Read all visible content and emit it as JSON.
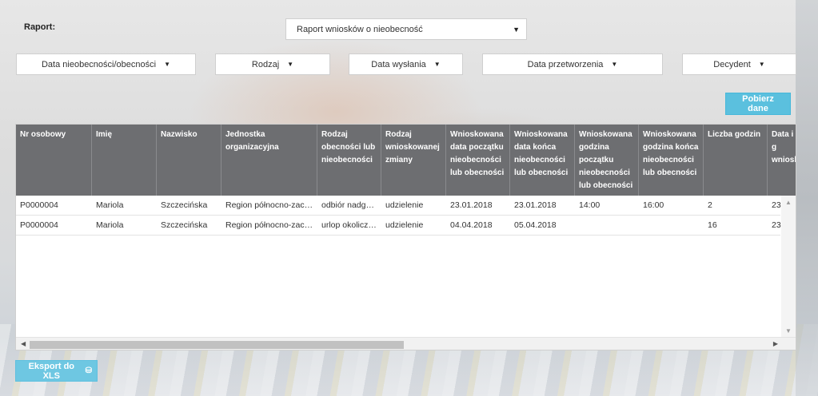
{
  "report": {
    "label": "Raport:",
    "selected": "Raport wniosków o nieobecność"
  },
  "filters": [
    {
      "label": "Data nieobecności/obecności"
    },
    {
      "label": "Rodzaj"
    },
    {
      "label": "Data wysłania"
    },
    {
      "label": "Data przetworzenia"
    },
    {
      "label": "Decydent"
    }
  ],
  "buttons": {
    "fetch": "Pobierz dane",
    "export": "Eksport do XLS"
  },
  "icons": {
    "caret": "▼",
    "filter_caret": "▼",
    "scroll_up": "▲",
    "scroll_down": "▼",
    "scroll_left": "◀",
    "scroll_right": "▶",
    "xls": "⛁"
  },
  "colors": {
    "header_bg": "#6d6e71",
    "button_bg": "#5bc0de"
  },
  "table": {
    "columns": [
      "Nr osobowy",
      "Imię",
      "Nazwisko",
      "Jednostka organizacyjna",
      "Rodzaj obecności lub nieobecności",
      "Rodzaj wnioskowanej zmiany",
      "Wnioskowana data początku nieobecności lub obecności",
      "Wnioskowana data końca nieobecności lub obecności",
      "Wnioskowana godzina początku nieobecności lub obecności",
      "Wnioskowana godzina końca nieobecności lub obecności",
      "Liczba godzin",
      "Data i g wniosk"
    ],
    "rows": [
      [
        "P0000004",
        "Mariola",
        "Szczecińska",
        "Region północno-zachodni",
        "odbiór nadgodzin",
        "udzielenie",
        "23.01.2018",
        "23.01.2018",
        "14:00",
        "16:00",
        "2",
        "23."
      ],
      [
        "P0000004",
        "Mariola",
        "Szczecińska",
        "Region północno-zachodni",
        "urlop okolicznościowy",
        "udzielenie",
        "04.04.2018",
        "05.04.2018",
        "",
        "",
        "16",
        "23."
      ]
    ]
  }
}
